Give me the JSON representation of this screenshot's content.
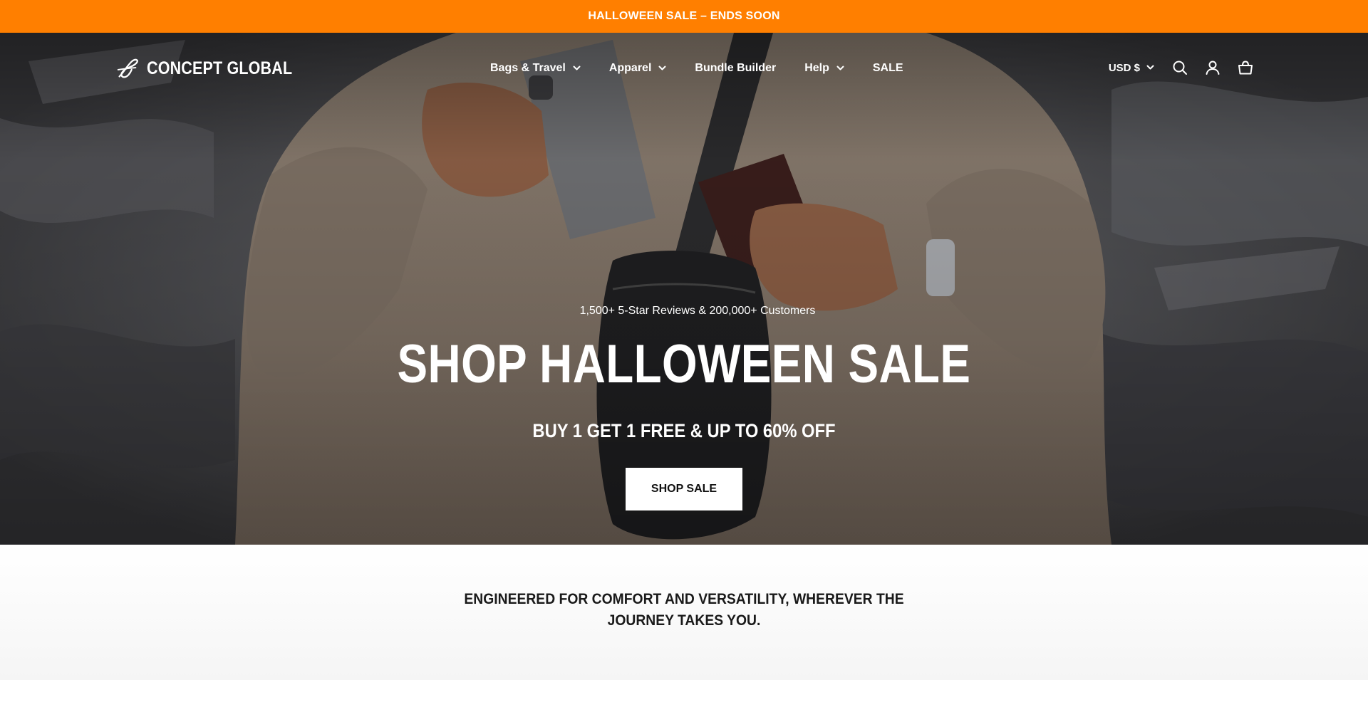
{
  "announcement": {
    "text": "HALLOWEEN SALE – ENDS SOON"
  },
  "brand": {
    "name": "CONCEPT GLOBAL"
  },
  "nav": {
    "items": [
      {
        "label": "Bags & Travel",
        "has_dropdown": true
      },
      {
        "label": "Apparel",
        "has_dropdown": true
      },
      {
        "label": "Bundle Builder",
        "has_dropdown": false
      },
      {
        "label": "Help",
        "has_dropdown": true
      },
      {
        "label": "SALE",
        "has_dropdown": false
      }
    ]
  },
  "utilities": {
    "currency": "USD $",
    "icons": [
      "search-icon",
      "account-icon",
      "cart-icon"
    ]
  },
  "hero": {
    "kicker": "1,500+ 5-Star Reviews & 200,000+ Customers",
    "title": "SHOP HALLOWEEN SALE",
    "subtitle": "BUY 1 GET 1 FREE & UP TO 60% OFF",
    "cta": "SHOP SALE"
  },
  "tagline": {
    "text": "ENGINEERED FOR COMFORT AND VERSATILITY, WHEREVER THE JOURNEY TAKES YOU."
  },
  "colors": {
    "announcement_bg": "#ff7f00",
    "cta_bg": "#ffffff",
    "text_light": "#ffffff",
    "text_dark": "#1a1a1a"
  }
}
